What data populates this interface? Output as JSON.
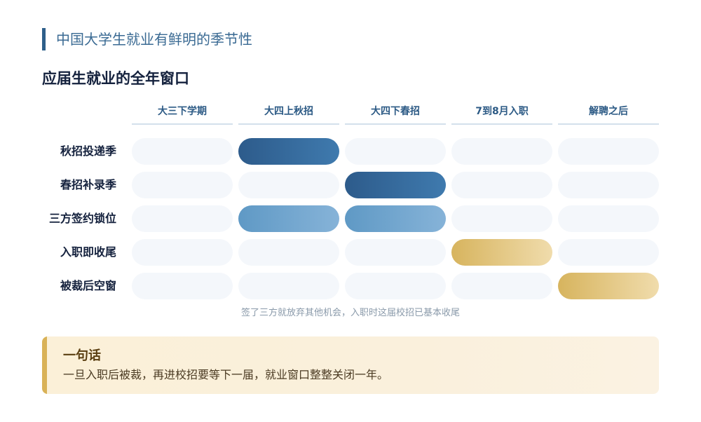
{
  "page": {
    "title": "中国大学生就业有鲜明的季节性"
  },
  "diagram": {
    "title": "应届生就业的全年窗口",
    "columns": [
      "大三下学期",
      "大四上秋招",
      "大四下春招",
      "7到8月入职",
      "解聘之后"
    ],
    "rows": [
      {
        "label": "秋招投递季",
        "cells": [
          "none",
          "dark",
          "none",
          "none",
          "none"
        ]
      },
      {
        "label": "春招补录季",
        "cells": [
          "none",
          "none",
          "dark",
          "none",
          "none"
        ]
      },
      {
        "label": "三方签约锁位",
        "cells": [
          "none",
          "light",
          "light",
          "none",
          "none"
        ]
      },
      {
        "label": "入职即收尾",
        "cells": [
          "none",
          "none",
          "none",
          "gold",
          "none"
        ]
      },
      {
        "label": "被裁后空窗",
        "cells": [
          "none",
          "none",
          "none",
          "none",
          "gold"
        ]
      }
    ],
    "note": "签了三方就放弃其他机会，入职时这届校招已基本收尾",
    "colors": {
      "dark": "#2d5b8b",
      "light": "#6fa4cd",
      "gold": "#dcb865",
      "empty": "#f4f7fb",
      "accent": "#2e5f8a"
    }
  },
  "callout": {
    "title": "一句话",
    "text": "一旦入职后被裁，再进校招要等下一届，就业窗口整整关闭一年。"
  }
}
